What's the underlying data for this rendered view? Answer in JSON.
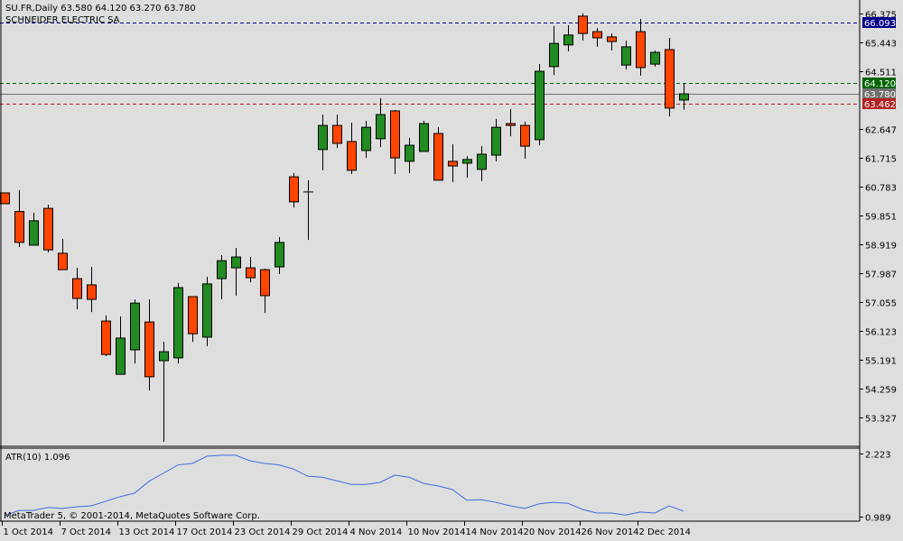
{
  "header": {
    "symbol_line": "SU.FR,Daily  63.580 64.120 63.270 63.780",
    "company": "SCHNEIDER ELECTRIC SA"
  },
  "footer": {
    "copyright": "MetaTrader 5, © 2001-2014, MetaQuotes Software Corp."
  },
  "colors": {
    "bull": "#228b22",
    "bear": "#ff4500",
    "background": "#dedede",
    "atr_line": "#4169e1",
    "ask_line": "#00008b",
    "high_line": "#006400",
    "last_line": "#707070",
    "low_line": "#b22222"
  },
  "chart_data": [
    {
      "type": "candlestick",
      "title": "SU.FR,Daily",
      "ylim": [
        52.6,
        66.6
      ],
      "y_ticks": [
        "66.375",
        "65.443",
        "64.511",
        "62.647",
        "61.715",
        "60.783",
        "59.851",
        "58.919",
        "57.987",
        "57.055",
        "56.123",
        "55.191",
        "54.259",
        "53.327"
      ],
      "x_tick_labels": [
        "1 Oct 2014",
        "7 Oct 2014",
        "13 Oct 2014",
        "17 Oct 2014",
        "23 Oct 2014",
        "29 Oct 2014",
        "4 Nov 2014",
        "10 Nov 2014",
        "14 Nov 2014",
        "20 Nov 2014",
        "26 Nov 2014",
        "2 Dec 2014"
      ],
      "x_tick_every": 4,
      "price_lines": [
        {
          "name": "ask",
          "value": 66.093,
          "label": "66.093",
          "color": "#00008b",
          "style": "dashed"
        },
        {
          "name": "day-high",
          "value": 64.12,
          "label": "64.120",
          "color": "#006400",
          "style": "dashed"
        },
        {
          "name": "last",
          "value": 63.78,
          "label": "63.780",
          "color": "#707070",
          "style": "solid"
        },
        {
          "name": "day-low",
          "value": 63.462,
          "label": "63.462",
          "color": "#b22222",
          "style": "dashed"
        }
      ],
      "ohlc": [
        [
          60.58,
          60.58,
          60.23,
          60.23
        ],
        [
          59.98,
          60.67,
          58.83,
          58.98
        ],
        [
          58.89,
          59.94,
          58.89,
          59.68
        ],
        [
          60.08,
          60.2,
          58.66,
          58.74
        ],
        [
          58.63,
          59.09,
          58.1,
          58.1
        ],
        [
          57.81,
          58.16,
          56.82,
          57.17
        ],
        [
          57.61,
          58.19,
          56.73,
          57.14
        ],
        [
          56.44,
          56.62,
          55.31,
          55.36
        ],
        [
          54.72,
          56.59,
          54.72,
          55.89
        ],
        [
          55.51,
          57.14,
          55.07,
          57.02
        ],
        [
          56.41,
          57.14,
          54.2,
          54.64
        ],
        [
          55.16,
          55.77,
          52.54,
          55.45
        ],
        [
          55.25,
          57.67,
          55.07,
          57.52
        ],
        [
          57.23,
          57.23,
          55.77,
          56.03
        ],
        [
          55.92,
          57.87,
          55.63,
          57.64
        ],
        [
          57.81,
          58.57,
          57.14,
          58.39
        ],
        [
          58.16,
          58.8,
          57.26,
          58.51
        ],
        [
          58.16,
          58.51,
          57.69,
          57.84
        ],
        [
          58.1,
          58.13,
          56.7,
          57.26
        ],
        [
          58.19,
          59.15,
          57.96,
          58.98
        ],
        [
          61.1,
          61.22,
          60.11,
          60.29
        ],
        [
          60.61,
          60.99,
          59.06,
          60.61
        ],
        [
          61.98,
          63.11,
          61.31,
          62.76
        ],
        [
          62.76,
          63.11,
          62.03,
          62.18
        ],
        [
          62.24,
          62.85,
          61.19,
          61.31
        ],
        [
          61.95,
          62.91,
          61.71,
          62.7
        ],
        [
          62.33,
          63.64,
          62.06,
          63.11
        ],
        [
          63.23,
          63.26,
          61.19,
          61.71
        ],
        [
          61.6,
          62.36,
          61.22,
          62.12
        ],
        [
          61.92,
          62.91,
          61.92,
          62.82
        ],
        [
          62.5,
          62.7,
          60.99,
          60.99
        ],
        [
          61.6,
          62.15,
          60.93,
          61.45
        ],
        [
          61.54,
          61.77,
          61.07,
          61.66
        ],
        [
          61.34,
          62.09,
          60.96,
          61.83
        ],
        [
          61.8,
          62.97,
          61.6,
          62.7
        ],
        [
          62.82,
          63.29,
          62.41,
          62.76
        ],
        [
          62.76,
          62.88,
          61.69,
          62.09
        ],
        [
          62.3,
          64.74,
          62.12,
          64.51
        ],
        [
          64.66,
          65.97,
          64.39,
          65.41
        ],
        [
          65.36,
          66.0,
          65.15,
          65.68
        ],
        [
          66.29,
          66.38,
          65.5,
          65.73
        ],
        [
          65.79,
          65.91,
          65.3,
          65.59
        ],
        [
          65.62,
          65.73,
          65.18,
          65.47
        ],
        [
          64.71,
          65.5,
          64.57,
          65.3
        ],
        [
          65.79,
          66.2,
          64.37,
          64.63
        ],
        [
          64.74,
          65.18,
          64.66,
          65.12
        ],
        [
          65.21,
          65.59,
          63.05,
          63.32
        ],
        [
          63.58,
          64.12,
          63.27,
          63.78
        ]
      ]
    },
    {
      "type": "line",
      "title": "ATR(10) 1.096",
      "ylim": [
        0.989,
        2.223
      ],
      "y_ticks": [
        "2.223",
        "0.989"
      ],
      "values": [
        1.01,
        1.11,
        1.11,
        1.17,
        1.15,
        1.18,
        1.2,
        1.29,
        1.38,
        1.45,
        1.68,
        1.84,
        2.0,
        2.03,
        2.17,
        2.19,
        2.19,
        2.08,
        2.03,
        2.0,
        1.92,
        1.78,
        1.76,
        1.69,
        1.62,
        1.62,
        1.66,
        1.8,
        1.76,
        1.64,
        1.59,
        1.52,
        1.31,
        1.32,
        1.27,
        1.2,
        1.15,
        1.24,
        1.27,
        1.25,
        1.13,
        1.06,
        1.06,
        1.02,
        1.08,
        1.06,
        1.2,
        1.096
      ]
    }
  ]
}
